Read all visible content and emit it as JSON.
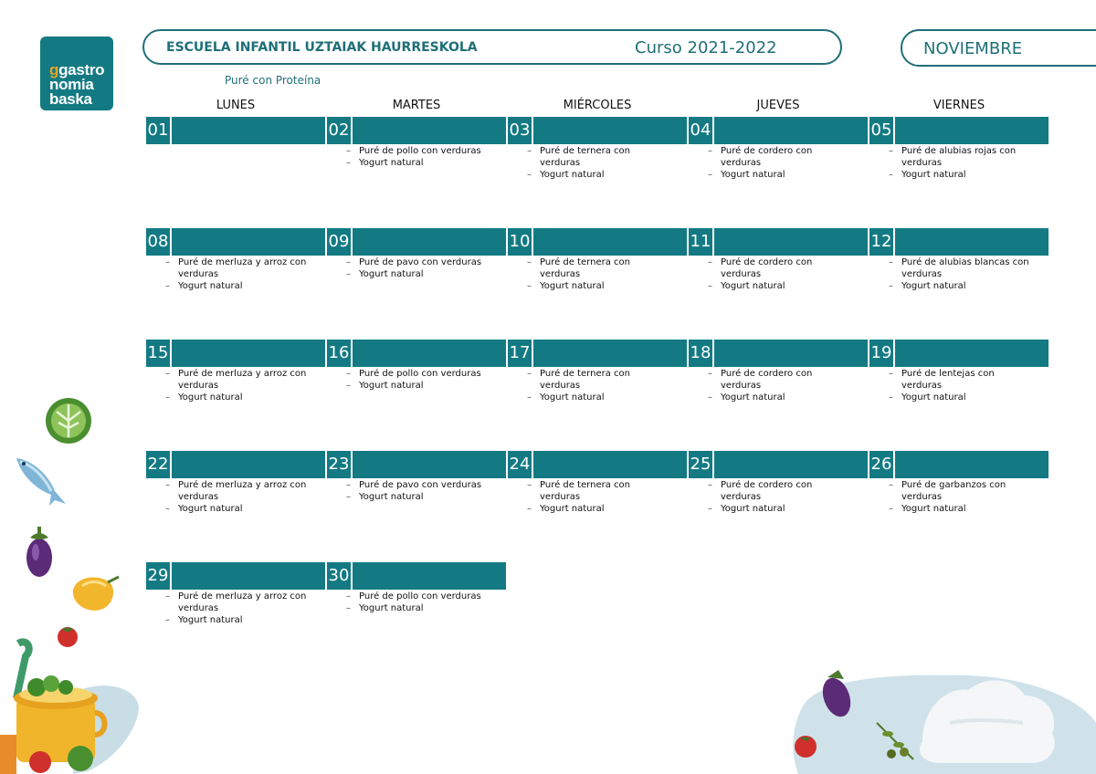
{
  "logo": {
    "line1": "gastro",
    "line2": "nomia",
    "line3": "baska"
  },
  "header": {
    "school": "ESCUELA INFANTIL UZTAIAK HAURRESKOLA",
    "course": "Curso 2021-2022",
    "month": "NOVIEMBRE"
  },
  "subtitle": "Puré con Proteína",
  "weekdays": [
    "LUNES",
    "MARTES",
    "MIÉRCOLES",
    "JUEVES",
    "VIERNES"
  ],
  "weeks": [
    [
      {
        "day": "01",
        "items": []
      },
      {
        "day": "02",
        "items": [
          "Puré de pollo con verduras",
          "Yogurt natural"
        ]
      },
      {
        "day": "03",
        "items": [
          "Puré de ternera con verduras",
          "Yogurt natural"
        ]
      },
      {
        "day": "04",
        "items": [
          "Puré de cordero con verduras",
          "Yogurt natural"
        ]
      },
      {
        "day": "05",
        "items": [
          "Puré de alubias rojas con verduras",
          "Yogurt natural"
        ]
      }
    ],
    [
      {
        "day": "08",
        "items": [
          "Puré de merluza y arroz con verduras",
          "Yogurt natural"
        ]
      },
      {
        "day": "09",
        "items": [
          "Puré de pavo con verduras",
          "Yogurt natural"
        ]
      },
      {
        "day": "10",
        "items": [
          "Puré de ternera con verduras",
          "Yogurt natural"
        ]
      },
      {
        "day": "11",
        "items": [
          "Puré de cordero con verduras",
          "Yogurt natural"
        ]
      },
      {
        "day": "12",
        "items": [
          "Puré de alubias blancas con verduras",
          "Yogurt natural"
        ]
      }
    ],
    [
      {
        "day": "15",
        "items": [
          "Puré de merluza y arroz con verduras",
          "Yogurt natural"
        ]
      },
      {
        "day": "16",
        "items": [
          "Puré de pollo con verduras",
          "Yogurt natural"
        ]
      },
      {
        "day": "17",
        "items": [
          "Puré de ternera con verduras",
          "Yogurt natural"
        ]
      },
      {
        "day": "18",
        "items": [
          "Puré de cordero con verduras",
          "Yogurt natural"
        ]
      },
      {
        "day": "19",
        "items": [
          "Puré de lentejas con verduras",
          "Yogurt natural"
        ]
      }
    ],
    [
      {
        "day": "22",
        "items": [
          "Puré de merluza y arroz con verduras",
          "Yogurt natural"
        ]
      },
      {
        "day": "23",
        "items": [
          "Puré de pavo con verduras",
          "Yogurt natural"
        ]
      },
      {
        "day": "24",
        "items": [
          "Puré de ternera con verduras",
          "Yogurt natural"
        ]
      },
      {
        "day": "25",
        "items": [
          "Puré de cordero con verduras",
          "Yogurt natural"
        ]
      },
      {
        "day": "26",
        "items": [
          "Puré de garbanzos con verduras",
          "Yogurt natural"
        ]
      }
    ],
    [
      {
        "day": "29",
        "items": [
          "Puré de merluza y arroz con verduras",
          "Yogurt natural"
        ]
      },
      {
        "day": "30",
        "items": [
          "Puré de pollo con verduras",
          "Yogurt natural"
        ]
      }
    ]
  ],
  "colors": {
    "teal": "#137a83",
    "text_teal": "#1f6f78"
  }
}
